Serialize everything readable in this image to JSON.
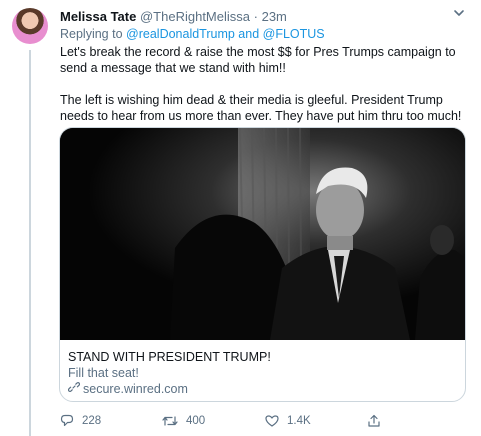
{
  "tweet": {
    "author_name": "Melissa Tate",
    "author_handle": "@TheRightMelissa",
    "separator": "·",
    "time": "23m",
    "reply_prefix": "Replying to",
    "reply_mentions": "@realDonaldTrump and @FLOTUS",
    "text_paragraph_1": "Let's break the record & raise the most $$ for Pres Trumps campaign to send a message that we stand with him!!",
    "text_paragraph_2": "The left is wishing him dead  & their media is gleeful. President Trump needs to hear from us more than ever. They have put him thru too much!"
  },
  "card": {
    "title": "STAND WITH PRESIDENT TRUMP!",
    "description": "Fill that seat!",
    "domain": "secure.winred.com"
  },
  "actions": {
    "replies": "228",
    "retweets": "400",
    "likes": "1.4K"
  },
  "icons": {
    "menu": "chevron-down-icon",
    "reply": "reply-icon",
    "retweet": "retweet-icon",
    "like": "heart-icon",
    "share": "share-icon",
    "link": "link-icon"
  },
  "colors": {
    "text": "#0f1419",
    "secondary": "#5b7083",
    "mention": "#1b95e0",
    "border": "#ccd6dd"
  }
}
